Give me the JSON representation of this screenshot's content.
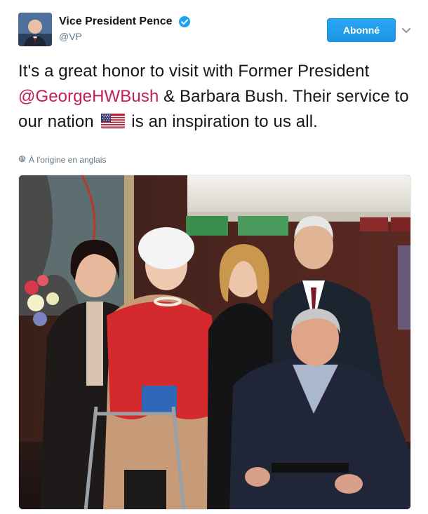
{
  "author": {
    "display_name": "Vice President Pence",
    "handle": "@VP",
    "verified": true
  },
  "follow_button": {
    "label": "Abonné"
  },
  "tweet": {
    "text_before": "It's a great honor to visit with Former President ",
    "mention": "@GeorgeHWBush",
    "text_middle": " & Barbara Bush. Their service to our nation ",
    "emoji": "us-flag",
    "text_after": " is an inspiration to us all."
  },
  "translation_note": "À l'origine en anglais",
  "icons": {
    "verified": "verified-badge-icon",
    "caret": "chevron-down-icon",
    "globe": "globe-icon"
  },
  "colors": {
    "brand_blue": "#1da1f2",
    "mention": "#c41e56",
    "secondary_text": "#657786"
  }
}
